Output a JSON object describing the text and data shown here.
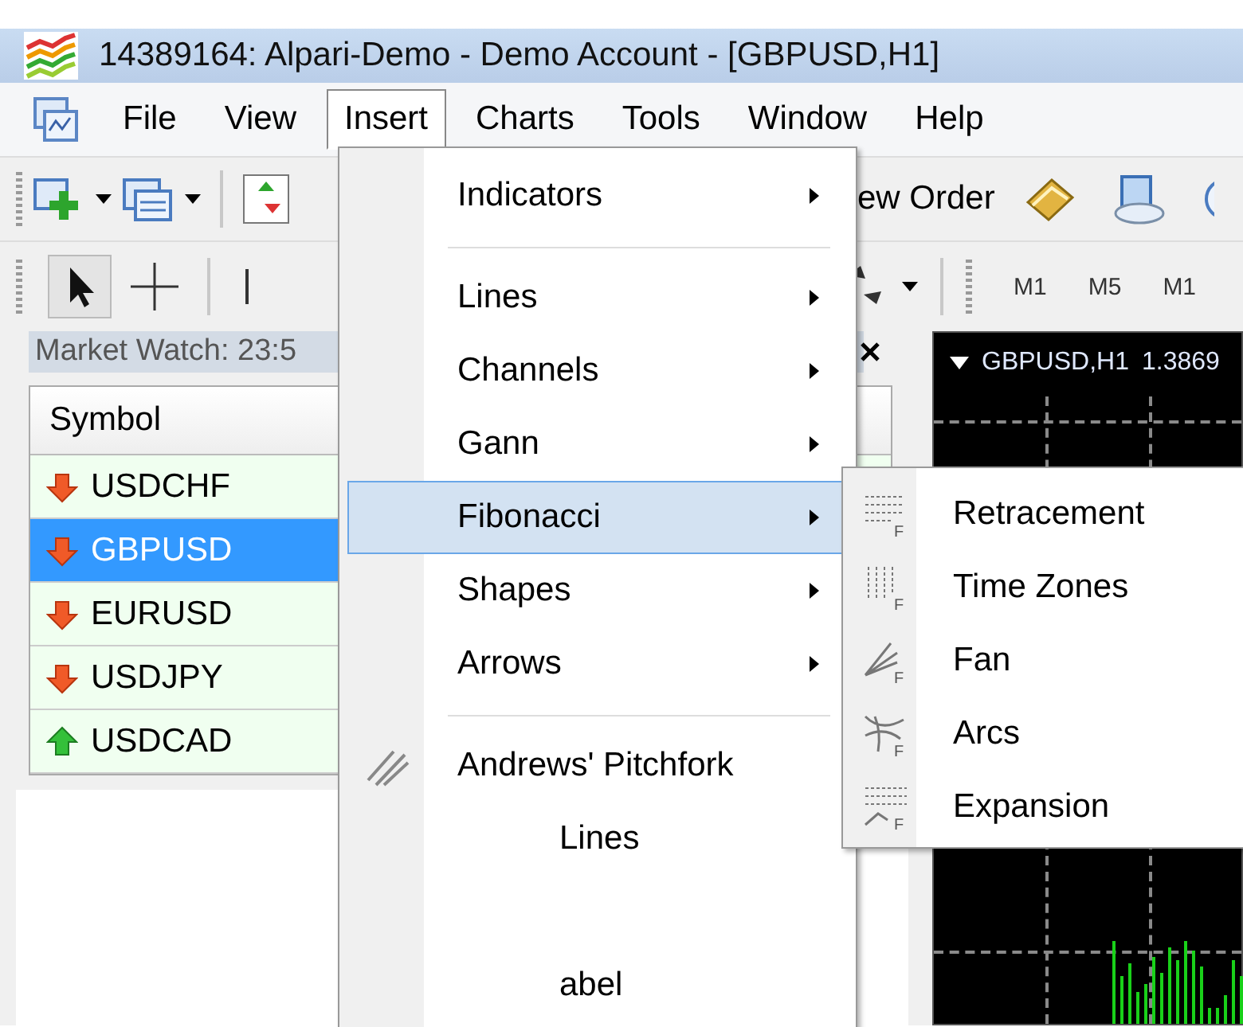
{
  "window": {
    "title": "14389164: Alpari-Demo - Demo Account - [GBPUSD,H1]"
  },
  "menu_bar": [
    {
      "label": "File",
      "selected": false
    },
    {
      "label": "View",
      "selected": false
    },
    {
      "label": "Insert",
      "selected": true
    },
    {
      "label": "Charts",
      "selected": false
    },
    {
      "label": "Tools",
      "selected": false
    },
    {
      "label": "Window",
      "selected": false
    },
    {
      "label": "Help",
      "selected": false
    }
  ],
  "toolbar": {
    "new_order": "ew Order"
  },
  "timeframes": [
    "M1",
    "M5",
    "M1"
  ],
  "market_watch": {
    "title": "Market Watch: 23:5",
    "column": "Symbol",
    "rows": [
      {
        "symbol": "USDCHF",
        "kind": "down",
        "selected": false
      },
      {
        "symbol": "GBPUSD",
        "kind": "down",
        "selected": true
      },
      {
        "symbol": "EURUSD",
        "kind": "down",
        "selected": false
      },
      {
        "symbol": "USDJPY",
        "kind": "down",
        "selected": false
      },
      {
        "symbol": "USDCAD",
        "kind": "up",
        "selected": false
      }
    ]
  },
  "chart": {
    "title": "GBPUSD,H1",
    "price": "1.3869"
  },
  "insert_menu": [
    {
      "kind": "item",
      "label": "Indicators",
      "submenu": true,
      "selected": false
    },
    {
      "kind": "separator"
    },
    {
      "kind": "item",
      "label": "Lines",
      "submenu": true,
      "selected": false
    },
    {
      "kind": "item",
      "label": "Channels",
      "submenu": true,
      "selected": false
    },
    {
      "kind": "item",
      "label": "Gann",
      "submenu": true,
      "selected": false
    },
    {
      "kind": "item",
      "label": "Fibonacci",
      "submenu": true,
      "selected": true
    },
    {
      "kind": "item",
      "label": "Shapes",
      "submenu": true,
      "selected": false
    },
    {
      "kind": "item",
      "label": "Arrows",
      "submenu": true,
      "selected": false
    },
    {
      "kind": "separator"
    },
    {
      "kind": "pitchfork",
      "label": "Andrews' Pitchfork",
      "submenu": false,
      "selected": false
    },
    {
      "kind": "partial",
      "label": "Lines"
    },
    {
      "kind": "covered"
    },
    {
      "kind": "partial",
      "label": "abel"
    }
  ],
  "fibonacci_submenu": [
    {
      "kind": "retracement",
      "badge": "F",
      "label": "Retracement"
    },
    {
      "kind": "time_zones",
      "badge": "F",
      "label": "Time Zones"
    },
    {
      "kind": "fan",
      "badge": "F",
      "label": "Fan"
    },
    {
      "kind": "arcs",
      "badge": "F",
      "label": "Arcs"
    },
    {
      "kind": "expansion",
      "badge": "F",
      "label": "Expansion"
    }
  ]
}
